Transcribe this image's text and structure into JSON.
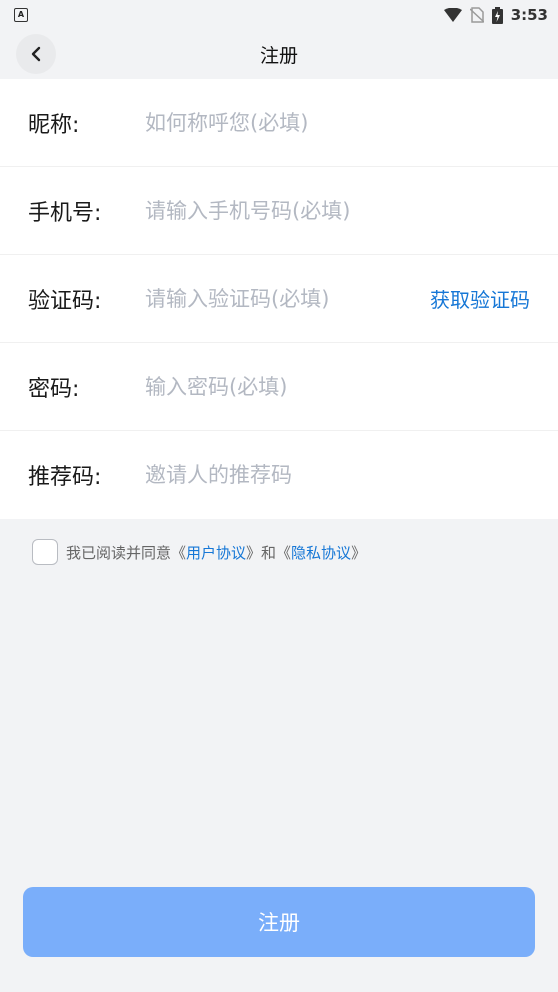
{
  "status_bar": {
    "left_icon_letter": "A",
    "time": "3:53"
  },
  "header": {
    "title": "注册"
  },
  "form": {
    "rows": [
      {
        "label": "昵称:",
        "placeholder": "如何称呼您(必填)"
      },
      {
        "label": "手机号:",
        "placeholder": "请输入手机号码(必填)"
      },
      {
        "label": "验证码:",
        "placeholder": "请输入验证码(必填)"
      },
      {
        "label": "密码:",
        "placeholder": "输入密码(必填)"
      },
      {
        "label": "推荐码:",
        "placeholder": "邀请人的推荐码"
      }
    ],
    "get_code_label": "获取验证码"
  },
  "agreement": {
    "prefix": "我已阅读并同意《",
    "user_agreement": "用户协议",
    "middle": "》和《",
    "privacy_agreement": "隐私协议",
    "suffix": "》",
    "checked": false
  },
  "submit": {
    "label": "注册"
  },
  "colors": {
    "accent": "#1677d6",
    "button": "#7aaefa",
    "background": "#f2f3f5"
  },
  "icons": [
    "back-chevron-icon",
    "wifi-icon",
    "no-sim-icon",
    "battery-charging-icon"
  ]
}
